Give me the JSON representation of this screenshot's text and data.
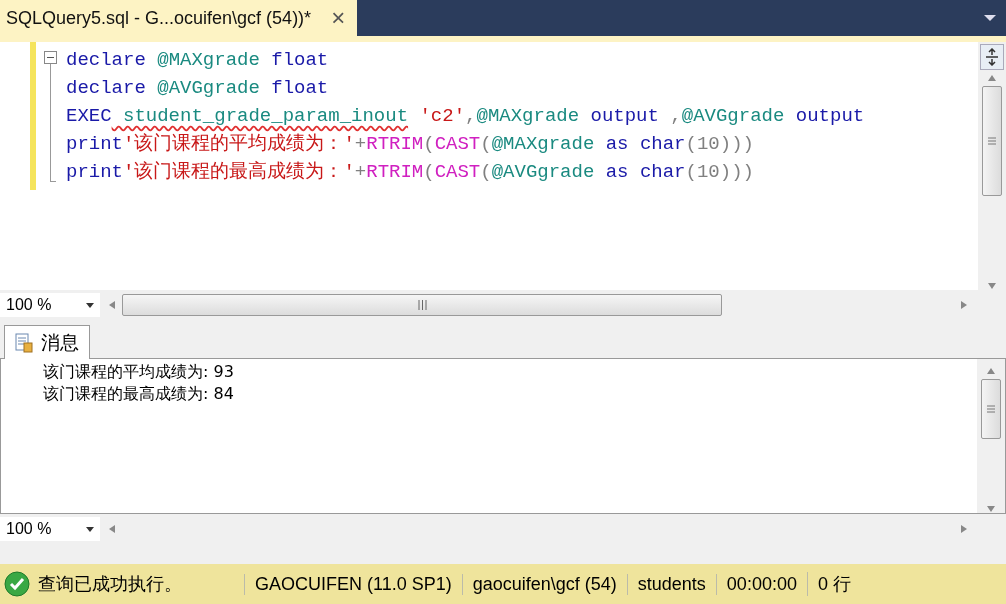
{
  "tab": {
    "title": "SQLQuery5.sql - G...ocuifen\\gcf (54))*",
    "close": "×"
  },
  "editor": {
    "lines": [
      [
        {
          "t": "declare",
          "kind": "keyword"
        },
        {
          "t": " @MAXgrade",
          "kind": "variable"
        },
        {
          "t": " float",
          "kind": "keyword"
        }
      ],
      [
        {
          "t": "declare",
          "kind": "keyword"
        },
        {
          "t": " @AVGgrade",
          "kind": "variable"
        },
        {
          "t": " float",
          "kind": "keyword"
        }
      ],
      [
        {
          "t": "EXEC",
          "kind": "keyword"
        },
        {
          "t": " student_grade_param_inout",
          "kind": "unresolved"
        },
        {
          "t": " 'c2'",
          "kind": "string"
        },
        {
          "t": ",",
          "kind": "plain"
        },
        {
          "t": "@MAXgrade",
          "kind": "variable"
        },
        {
          "t": " output",
          "kind": "keyword"
        },
        {
          "t": " ,",
          "kind": "plain"
        },
        {
          "t": "@AVGgrade",
          "kind": "variable"
        },
        {
          "t": " output",
          "kind": "keyword"
        }
      ],
      [
        {
          "t": "print",
          "kind": "keyword"
        },
        {
          "t": "'该门课程的平均成绩为：'",
          "kind": "string"
        },
        {
          "t": "+",
          "kind": "plain"
        },
        {
          "t": "RTRIM",
          "kind": "function"
        },
        {
          "t": "(",
          "kind": "plain"
        },
        {
          "t": "CAST",
          "kind": "function"
        },
        {
          "t": "(",
          "kind": "plain"
        },
        {
          "t": "@MAXgrade",
          "kind": "variable"
        },
        {
          "t": " as",
          "kind": "keyword"
        },
        {
          "t": " char",
          "kind": "keyword"
        },
        {
          "t": "(10)))",
          "kind": "plain"
        }
      ],
      [
        {
          "t": "print",
          "kind": "keyword"
        },
        {
          "t": "'该门课程的最高成绩为：'",
          "kind": "string"
        },
        {
          "t": "+",
          "kind": "plain"
        },
        {
          "t": "RTRIM",
          "kind": "function"
        },
        {
          "t": "(",
          "kind": "plain"
        },
        {
          "t": "CAST",
          "kind": "function"
        },
        {
          "t": "(",
          "kind": "plain"
        },
        {
          "t": "@AVGgrade",
          "kind": "variable"
        },
        {
          "t": " as",
          "kind": "keyword"
        },
        {
          "t": " char",
          "kind": "keyword"
        },
        {
          "t": "(10)))",
          "kind": "plain"
        }
      ]
    ],
    "zoom": "100 %"
  },
  "results": {
    "tab": "消息",
    "messages": [
      "该门课程的平均成绩为: 93",
      "该门课程的最高成绩为: 84"
    ],
    "zoom": "100 %"
  },
  "status_bar": {
    "message": "查询已成功执行。",
    "fields": [
      "GAOCUIFEN (11.0 SP1)",
      "gaocuifen\\gcf (54)",
      "students",
      "00:00:00",
      "0 行"
    ]
  }
}
